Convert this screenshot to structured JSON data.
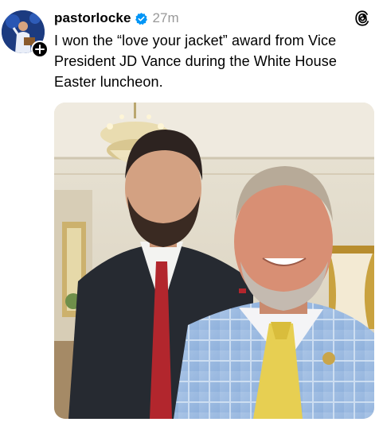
{
  "post": {
    "username": "pastorlocke",
    "timestamp": "27m",
    "text": "I won the “love your jacket” award from Vice President JD Vance during the White House Easter luncheon."
  },
  "icons": {
    "verified": "verified-badge-icon",
    "app": "threads-logo-icon",
    "follow": "plus-icon"
  },
  "colors": {
    "verified_blue": "#0095f6",
    "timestamp_gray": "#999999"
  }
}
